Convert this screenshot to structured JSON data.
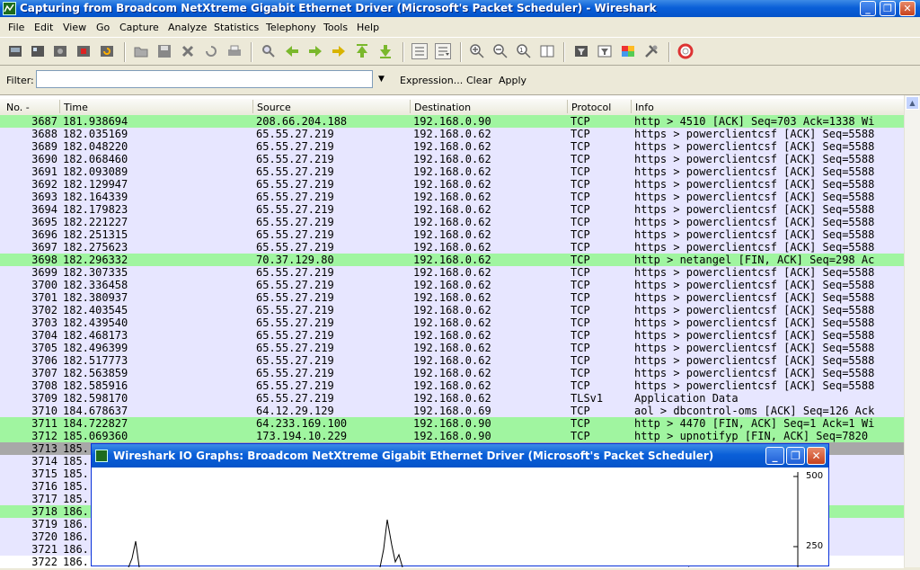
{
  "window": {
    "title": "Capturing from Broadcom NetXtreme Gigabit Ethernet Driver (Microsoft's Packet Scheduler)  - Wireshark"
  },
  "menu": [
    "File",
    "Edit",
    "View",
    "Go",
    "Capture",
    "Analyze",
    "Statistics",
    "Telephony",
    "Tools",
    "Help"
  ],
  "filter": {
    "label": "Filter:",
    "value": "",
    "expression_label": "Expression...",
    "clear_label": "Clear",
    "apply_label": "Apply"
  },
  "columns": [
    "No. -",
    "Time",
    "Source",
    "Destination",
    "Protocol",
    "Info"
  ],
  "packets": [
    {
      "no": "3687",
      "time": "181.938694",
      "src": "208.66.204.188",
      "dst": "192.168.0.90",
      "proto": "TCP",
      "info": "http > 4510 [ACK] Seq=703 Ack=1338 Wi",
      "color": "g"
    },
    {
      "no": "3688",
      "time": "182.035169",
      "src": "65.55.27.219",
      "dst": "192.168.0.62",
      "proto": "TCP",
      "info": "https > powerclientcsf [ACK] Seq=5588",
      "color": "b"
    },
    {
      "no": "3689",
      "time": "182.048220",
      "src": "65.55.27.219",
      "dst": "192.168.0.62",
      "proto": "TCP",
      "info": "https > powerclientcsf [ACK] Seq=5588",
      "color": "b"
    },
    {
      "no": "3690",
      "time": "182.068460",
      "src": "65.55.27.219",
      "dst": "192.168.0.62",
      "proto": "TCP",
      "info": "https > powerclientcsf [ACK] Seq=5588",
      "color": "b"
    },
    {
      "no": "3691",
      "time": "182.093089",
      "src": "65.55.27.219",
      "dst": "192.168.0.62",
      "proto": "TCP",
      "info": "https > powerclientcsf [ACK] Seq=5588",
      "color": "b"
    },
    {
      "no": "3692",
      "time": "182.129947",
      "src": "65.55.27.219",
      "dst": "192.168.0.62",
      "proto": "TCP",
      "info": "https > powerclientcsf [ACK] Seq=5588",
      "color": "b"
    },
    {
      "no": "3693",
      "time": "182.164339",
      "src": "65.55.27.219",
      "dst": "192.168.0.62",
      "proto": "TCP",
      "info": "https > powerclientcsf [ACK] Seq=5588",
      "color": "b"
    },
    {
      "no": "3694",
      "time": "182.179823",
      "src": "65.55.27.219",
      "dst": "192.168.0.62",
      "proto": "TCP",
      "info": "https > powerclientcsf [ACK] Seq=5588",
      "color": "b"
    },
    {
      "no": "3695",
      "time": "182.221227",
      "src": "65.55.27.219",
      "dst": "192.168.0.62",
      "proto": "TCP",
      "info": "https > powerclientcsf [ACK] Seq=5588",
      "color": "b"
    },
    {
      "no": "3696",
      "time": "182.251315",
      "src": "65.55.27.219",
      "dst": "192.168.0.62",
      "proto": "TCP",
      "info": "https > powerclientcsf [ACK] Seq=5588",
      "color": "b"
    },
    {
      "no": "3697",
      "time": "182.275623",
      "src": "65.55.27.219",
      "dst": "192.168.0.62",
      "proto": "TCP",
      "info": "https > powerclientcsf [ACK] Seq=5588",
      "color": "b"
    },
    {
      "no": "3698",
      "time": "182.296332",
      "src": "70.37.129.80",
      "dst": "192.168.0.62",
      "proto": "TCP",
      "info": "http > netangel [FIN, ACK] Seq=298 Ac",
      "color": "g"
    },
    {
      "no": "3699",
      "time": "182.307335",
      "src": "65.55.27.219",
      "dst": "192.168.0.62",
      "proto": "TCP",
      "info": "https > powerclientcsf [ACK] Seq=5588",
      "color": "b"
    },
    {
      "no": "3700",
      "time": "182.336458",
      "src": "65.55.27.219",
      "dst": "192.168.0.62",
      "proto": "TCP",
      "info": "https > powerclientcsf [ACK] Seq=5588",
      "color": "b"
    },
    {
      "no": "3701",
      "time": "182.380937",
      "src": "65.55.27.219",
      "dst": "192.168.0.62",
      "proto": "TCP",
      "info": "https > powerclientcsf [ACK] Seq=5588",
      "color": "b"
    },
    {
      "no": "3702",
      "time": "182.403545",
      "src": "65.55.27.219",
      "dst": "192.168.0.62",
      "proto": "TCP",
      "info": "https > powerclientcsf [ACK] Seq=5588",
      "color": "b"
    },
    {
      "no": "3703",
      "time": "182.439540",
      "src": "65.55.27.219",
      "dst": "192.168.0.62",
      "proto": "TCP",
      "info": "https > powerclientcsf [ACK] Seq=5588",
      "color": "b"
    },
    {
      "no": "3704",
      "time": "182.468173",
      "src": "65.55.27.219",
      "dst": "192.168.0.62",
      "proto": "TCP",
      "info": "https > powerclientcsf [ACK] Seq=5588",
      "color": "b"
    },
    {
      "no": "3705",
      "time": "182.496399",
      "src": "65.55.27.219",
      "dst": "192.168.0.62",
      "proto": "TCP",
      "info": "https > powerclientcsf [ACK] Seq=5588",
      "color": "b"
    },
    {
      "no": "3706",
      "time": "182.517773",
      "src": "65.55.27.219",
      "dst": "192.168.0.62",
      "proto": "TCP",
      "info": "https > powerclientcsf [ACK] Seq=5588",
      "color": "b"
    },
    {
      "no": "3707",
      "time": "182.563859",
      "src": "65.55.27.219",
      "dst": "192.168.0.62",
      "proto": "TCP",
      "info": "https > powerclientcsf [ACK] Seq=5588",
      "color": "b"
    },
    {
      "no": "3708",
      "time": "182.585916",
      "src": "65.55.27.219",
      "dst": "192.168.0.62",
      "proto": "TCP",
      "info": "https > powerclientcsf [ACK] Seq=5588",
      "color": "b"
    },
    {
      "no": "3709",
      "time": "182.598170",
      "src": "65.55.27.219",
      "dst": "192.168.0.62",
      "proto": "TLSv1",
      "info": "Application Data",
      "color": "b"
    },
    {
      "no": "3710",
      "time": "184.678637",
      "src": "64.12.29.129",
      "dst": "192.168.0.69",
      "proto": "TCP",
      "info": "aol > dbcontrol-oms [ACK] Seq=126 Ack",
      "color": "b"
    },
    {
      "no": "3711",
      "time": "184.722827",
      "src": "64.233.169.100",
      "dst": "192.168.0.90",
      "proto": "TCP",
      "info": "http > 4470 [FIN, ACK] Seq=1 Ack=1 Wi",
      "color": "g"
    },
    {
      "no": "3712",
      "time": "185.069360",
      "src": "173.194.10.229",
      "dst": "192.168.0.90",
      "proto": "TCP",
      "info": "http > upnotifyp [FIN, ACK] Seq=7820",
      "color": "g"
    },
    {
      "no": "3713",
      "time": "185.",
      "src": "",
      "dst": "",
      "proto": "",
      "info": "Seq=0 Ack=",
      "color": "k"
    },
    {
      "no": "3714",
      "time": "185.",
      "src": "",
      "dst": "",
      "proto": "",
      "info": "",
      "color": "b"
    },
    {
      "no": "3715",
      "time": "185.",
      "src": "",
      "dst": "",
      "proto": "",
      "info": "9 Ack=32 W",
      "color": "b"
    },
    {
      "no": "3716",
      "time": "185.",
      "src": "",
      "dst": "",
      "proto": "",
      "info": "",
      "color": "b"
    },
    {
      "no": "3717",
      "time": "185.",
      "src": "",
      "dst": "",
      "proto": "",
      "info": "",
      "color": "b"
    },
    {
      "no": "3718",
      "time": "186.",
      "src": "",
      "dst": "",
      "proto": "",
      "info": "Seq=1 Ack=",
      "color": "g"
    },
    {
      "no": "3719",
      "time": "186.",
      "src": "",
      "dst": "",
      "proto": "",
      "info": "",
      "color": "b"
    },
    {
      "no": "3720",
      "time": "186.",
      "src": "",
      "dst": "",
      "proto": "",
      "info": "",
      "color": "b"
    },
    {
      "no": "3721",
      "time": "186.",
      "src": "",
      "dst": "",
      "proto": "",
      "info": "",
      "color": "b"
    },
    {
      "no": "3722",
      "time": "186.",
      "src": "",
      "dst": "",
      "proto": "",
      "info": "eak here, ",
      "color": "w"
    }
  ],
  "io_graph": {
    "title": "Wireshark IO Graphs: Broadcom NetXtreme Gigabit Ethernet Driver (Microsoft's Packet Scheduler)",
    "y_ticks": [
      "500",
      "250"
    ]
  },
  "colors": {
    "titlebar": "#0a5fd8",
    "green_row": "#a0f5a0",
    "lavender_row": "#e7e6ff",
    "gray_row": "#a8a8a8"
  }
}
